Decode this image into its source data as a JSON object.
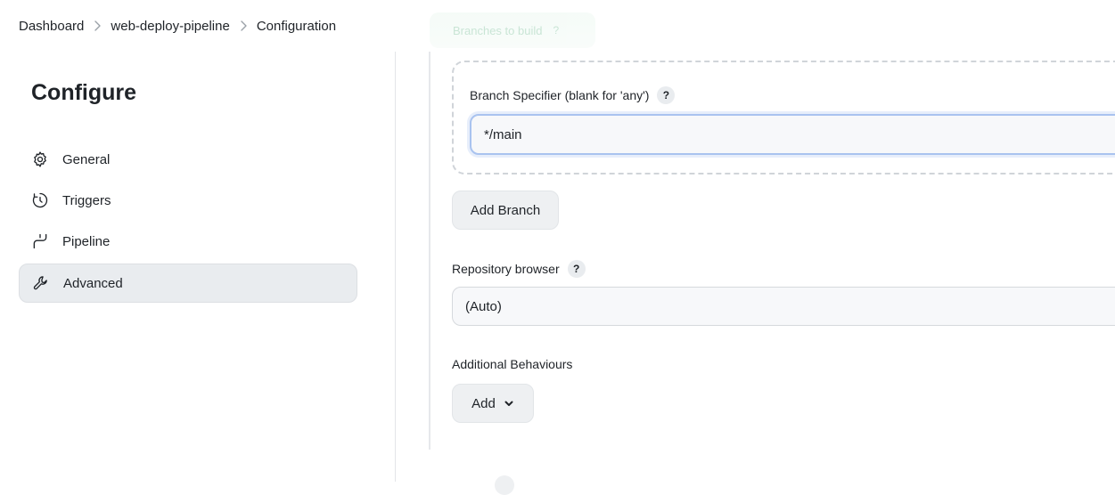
{
  "breadcrumb": {
    "items": [
      "Dashboard",
      "web-deploy-pipeline",
      "Configuration"
    ]
  },
  "sticky_header": {
    "label": "Branches to build",
    "help": "?"
  },
  "sidebar": {
    "title": "Configure",
    "items": [
      {
        "label": "General",
        "icon": "gear-icon"
      },
      {
        "label": "Triggers",
        "icon": "timer-icon"
      },
      {
        "label": "Pipeline",
        "icon": "pipeline-icon"
      },
      {
        "label": "Advanced",
        "icon": "wrench-icon",
        "active": true
      }
    ]
  },
  "branch": {
    "specifier_label": "Branch Specifier (blank for 'any')",
    "specifier_help": "?",
    "specifier_value": "*/main",
    "add_branch_label": "Add Branch"
  },
  "repository_browser": {
    "label": "Repository browser",
    "help": "?",
    "value": "(Auto)"
  },
  "additional_behaviours": {
    "label": "Additional Behaviours",
    "add_label": "Add"
  },
  "colors": {
    "active_nav_bg": "#e9ecef",
    "focus_border": "#a9c3ef",
    "text": "#1f2328"
  }
}
